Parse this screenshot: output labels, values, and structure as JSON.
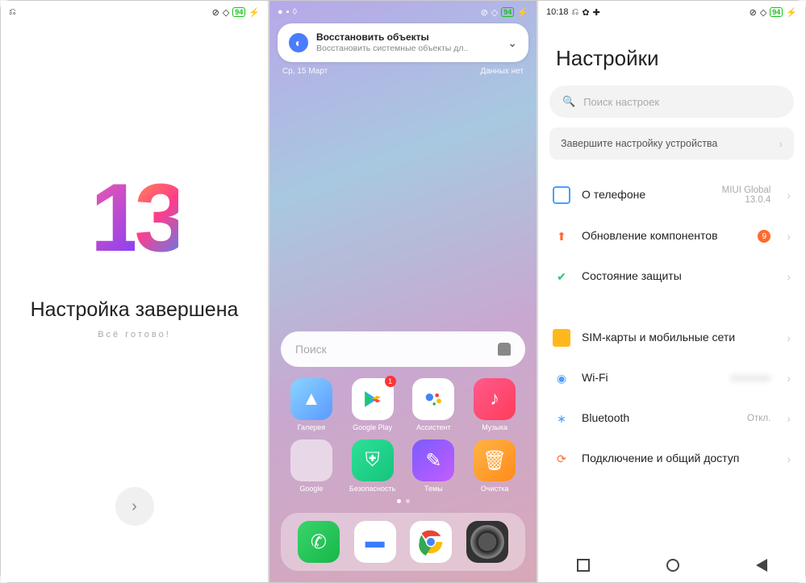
{
  "status": {
    "battery": "94",
    "time": "10:18"
  },
  "screen1": {
    "title": "Настройка завершена",
    "subtitle": "Всё готово!"
  },
  "screen2": {
    "notification": {
      "title": "Восстановить объекты",
      "subtitle": "Восстановить системные объекты дл.."
    },
    "date": "Ср, 15 Март",
    "data_status": "Данных нет",
    "search_placeholder": "Поиск",
    "apps_row1": [
      {
        "label": "Галерея",
        "icon": "gallery"
      },
      {
        "label": "Google Play",
        "icon": "play",
        "badge": "1"
      },
      {
        "label": "Ассистент",
        "icon": "assistant"
      },
      {
        "label": "Музыка",
        "icon": "music"
      }
    ],
    "apps_row2": [
      {
        "label": "Google",
        "icon": "folder"
      },
      {
        "label": "Безопасность",
        "icon": "security"
      },
      {
        "label": "Темы",
        "icon": "themes"
      },
      {
        "label": "Очистка",
        "icon": "cleaner"
      }
    ],
    "dock": [
      {
        "label": "Телефон",
        "icon": "phone"
      },
      {
        "label": "Сообщения",
        "icon": "messages"
      },
      {
        "label": "Chrome",
        "icon": "chrome"
      },
      {
        "label": "Камера",
        "icon": "camera"
      }
    ]
  },
  "screen3": {
    "title": "Настройки",
    "search_placeholder": "Поиск настроек",
    "banner": "Завершите настройку устройства",
    "group1": [
      {
        "icon": "phone-about",
        "color": "#4a9eff",
        "label": "О телефоне",
        "value": "MIUI Global 13.0.4"
      },
      {
        "icon": "update",
        "color": "#ff6b2c",
        "label": "Обновление компонентов",
        "badge": "9"
      },
      {
        "icon": "shield",
        "color": "#1ec774",
        "label": "Состояние защиты"
      }
    ],
    "group2": [
      {
        "icon": "sim",
        "color": "#ffb81c",
        "label": "SIM-карты и мобильные сети"
      },
      {
        "icon": "wifi",
        "color": "#4a9eff",
        "label": "Wi-Fi",
        "value": " "
      },
      {
        "icon": "bluetooth",
        "color": "#4a9eff",
        "label": "Bluetooth",
        "value": "Откл."
      },
      {
        "icon": "share",
        "color": "#ff6b2c",
        "label": "Подключение и общий доступ"
      }
    ]
  }
}
